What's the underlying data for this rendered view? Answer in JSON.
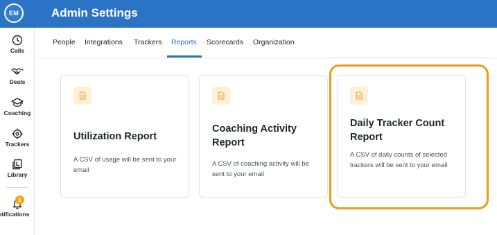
{
  "app": {
    "header_title": "Admin Settings"
  },
  "user": {
    "initials": "EM"
  },
  "sidebar": {
    "items": [
      {
        "label": "Calls",
        "icon": "clock-icon"
      },
      {
        "label": "Deals",
        "icon": "handshake-icon"
      },
      {
        "label": "Coaching",
        "icon": "graduation-cap-icon"
      },
      {
        "label": "Trackers",
        "icon": "target-icon"
      },
      {
        "label": "Library",
        "icon": "library-icon"
      },
      {
        "label": "Notifications",
        "icon": "bell-icon",
        "badge": "1"
      }
    ]
  },
  "tabs": [
    {
      "label": "People"
    },
    {
      "label": "Integrations"
    },
    {
      "label": "Trackers"
    },
    {
      "label": "Reports",
      "active": true
    },
    {
      "label": "Scorecards"
    },
    {
      "label": "Organization"
    }
  ],
  "reports": [
    {
      "title": "Utilization Report",
      "description": "A CSV of usage will be sent to your email",
      "icon": "document-icon"
    },
    {
      "title": "Coaching Activity Report",
      "description": "A CSV of coaching activity will be sent to your email",
      "icon": "document-icon"
    },
    {
      "title": "Daily Tracker Count Report",
      "description": "A CSV of daily counts of selected trackers will be sent to your email",
      "icon": "document-icon",
      "highlighted": true
    }
  ],
  "colors": {
    "brand": "#2b73c4",
    "highlight": "#ef9a1a",
    "badge": "#f2a516",
    "icon_bg": "#fdf0d4"
  }
}
